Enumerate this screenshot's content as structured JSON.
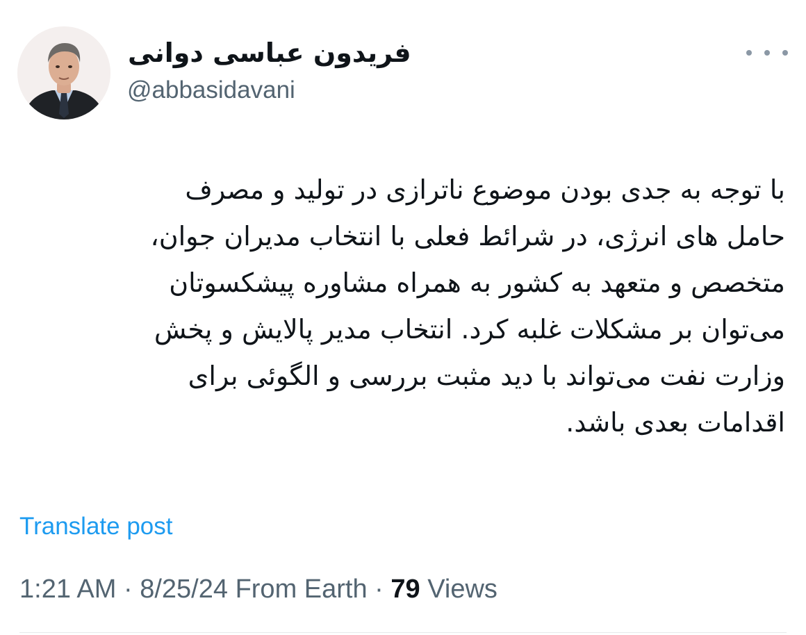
{
  "author": {
    "display_name": "فریدون عباسی دوانی",
    "handle": "@abbasidavani",
    "avatar_icon": "person-portrait-avatar"
  },
  "menu_icon": "more-options-icon",
  "tweet": {
    "lines": [
      "با توجه به جدی بودن موضوع ناترازی در تولید و مصرف",
      "حامل های انرژی، در شرائط فعلی با انتخاب مدیران جوان،",
      "متخصص و متعهد به کشور به همراه مشاوره پیشکسوتان",
      "می‌توان بر مشکلات غلبه کرد. انتخاب مدیر پالایش و پخش",
      "وزارت نفت می‌تواند با دید مثبت بررسی و الگوئی برای",
      "اقدامات بعدی باشد."
    ]
  },
  "translate_label": "Translate post",
  "meta": {
    "time": "1:21 AM",
    "separator": " · ",
    "date": "8/25/24",
    "source": "From Earth",
    "views_count": "79",
    "views_label": "Views"
  },
  "colors": {
    "link": "#1d9bf0",
    "secondary_text": "#536471",
    "primary_text": "#0f1419"
  }
}
